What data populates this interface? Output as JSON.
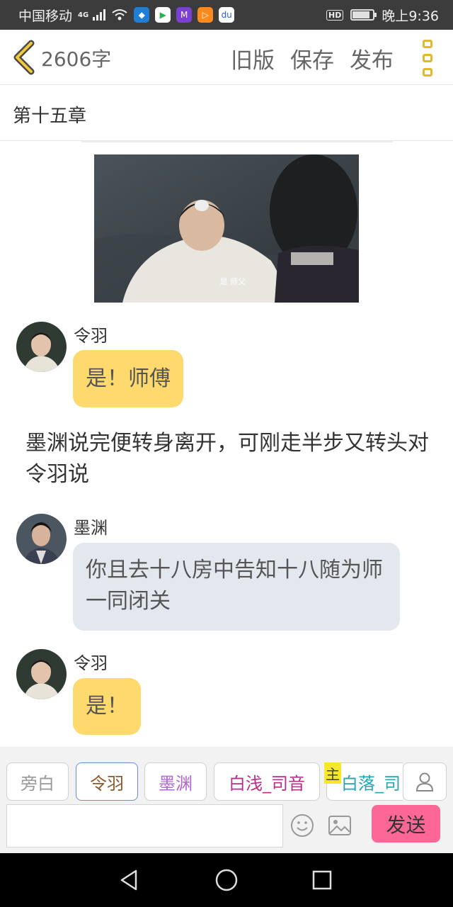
{
  "status_bar": {
    "carrier": "中国移动",
    "network": "4G",
    "hd": "HD",
    "time": "晚上9:36",
    "battery_level": 0.85,
    "app_icons": [
      "shield-app",
      "video-app",
      "cat-app",
      "play-app",
      "baidu-app"
    ]
  },
  "toolbar": {
    "word_count": "2606字",
    "old_version": "旧版",
    "save": "保存",
    "publish": "发布"
  },
  "chapter": {
    "title": "第十五章"
  },
  "scene": {
    "subtitle": "是 师父"
  },
  "messages": [
    {
      "speaker": "令羽",
      "text": "是！师傅",
      "style": "yellow"
    },
    {
      "narration": "墨渊说完便转身离开，可刚走半步又转头对令羽说"
    },
    {
      "speaker": "墨渊",
      "text": "你且去十八房中告知十八随为师一同闭关",
      "style": "gray"
    },
    {
      "speaker": "令羽",
      "text": "是！",
      "style": "yellow"
    }
  ],
  "characters": [
    {
      "label": "旁白",
      "color": "#999999",
      "selected": false
    },
    {
      "label": "令羽",
      "color": "#8b5a2b",
      "selected": true
    },
    {
      "label": "墨渊",
      "color": "#b066d1",
      "selected": false
    },
    {
      "label": "白浅_司音",
      "color": "#b5308a",
      "selected": false
    },
    {
      "label": "白落_司",
      "color": "#2aa5b5",
      "selected": false,
      "main_tag": "主"
    }
  ],
  "input": {
    "placeholder": "",
    "send": "发送"
  },
  "colors": {
    "accent_yellow": "#fed96e",
    "send_pink": "#fd6798",
    "gray_bubble": "#e3e8ef"
  }
}
